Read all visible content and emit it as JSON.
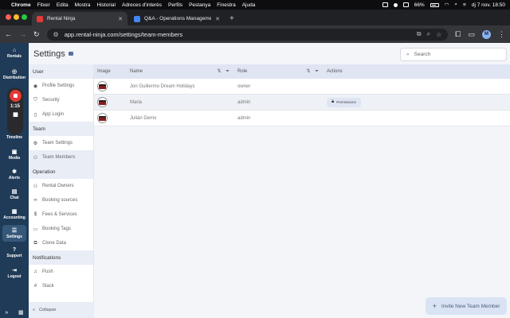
{
  "menubar": {
    "app": "Chrome",
    "items": [
      "Fitxer",
      "Edita",
      "Mostra",
      "Historial",
      "Adreces d'interès",
      "Perfils",
      "Pestanya",
      "Finestra",
      "Ajuda"
    ],
    "battery": "66%",
    "datetime": "dj 7 nov.  18:50"
  },
  "browser": {
    "tabs": [
      {
        "title": "Rental Ninja",
        "active": true,
        "color": "#e53935"
      },
      {
        "title": "Q&A - Operations Managemen",
        "active": false,
        "color": "#4285f4"
      }
    ],
    "new_tab": "+",
    "url": "app.rental-ninja.com/settings/team-members",
    "profile_initial": "M"
  },
  "rail": {
    "items": [
      {
        "label": "Rentals",
        "icon": "home-icon"
      },
      {
        "label": "Distribution",
        "icon": "globe-icon"
      },
      {
        "label": "Timeline",
        "icon": "timeline-icon"
      },
      {
        "label": "Media",
        "icon": "media-icon"
      },
      {
        "label": "Alerts",
        "icon": "bell-icon"
      },
      {
        "label": "Chat",
        "icon": "chat-icon"
      },
      {
        "label": "Accounting",
        "icon": "calculator-icon"
      },
      {
        "label": "Settings",
        "icon": "settings-icon",
        "active": true
      },
      {
        "label": "Support",
        "icon": "help-icon"
      },
      {
        "label": "Logout",
        "icon": "logout-icon"
      }
    ],
    "recorder_time": "1:15"
  },
  "header": {
    "title": "Settings",
    "search_placeholder": "Search"
  },
  "settings_nav": {
    "sections": [
      {
        "title": "User",
        "items": [
          "Profile Settings",
          "Security",
          "App Login"
        ]
      },
      {
        "title": "Team",
        "items": [
          "Team Settings",
          "Team Members"
        ]
      },
      {
        "title": "Operation",
        "items": [
          "Rental Owners",
          "Booking sources",
          "Fees & Services",
          "Booking Tags",
          "Clone Data"
        ]
      },
      {
        "title": "Notifications",
        "items": [
          "Push",
          "Slack"
        ]
      }
    ],
    "active_item": "Team Members",
    "collapse": "Collapse"
  },
  "table": {
    "columns": [
      "Image",
      "Name",
      "Role",
      "Actions"
    ],
    "rows": [
      {
        "name": "Jon Guillermo Dream Holidays",
        "role": "owner",
        "action": ""
      },
      {
        "name": "Maria",
        "role": "admin",
        "action": "Permissions"
      },
      {
        "name": "Julián Demo",
        "role": "admin",
        "action": ""
      }
    ]
  },
  "invite_button": "Invite New Team Member",
  "colors": {
    "rail": "#1f3b57",
    "header_row": "#dfe5f3",
    "accent": "#d9e3f3"
  }
}
